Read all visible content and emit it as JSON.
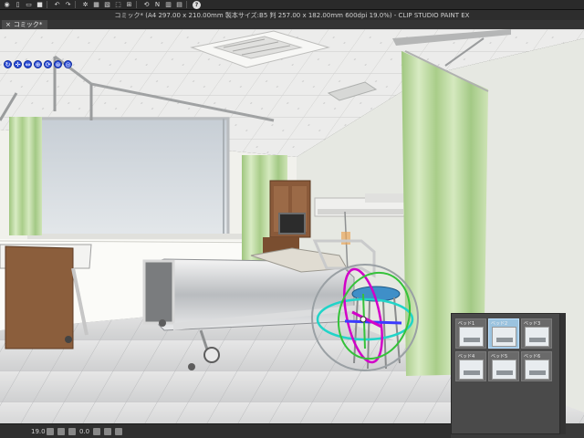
{
  "app": {
    "window_title": "コミック* (A4 297.00 x 210.00mm 製本サイズ:B5 判 257.00 x 182.00mm 600dpi 19.0%) - CLIP STUDIO PAINT EX",
    "document_tab": "コミック*"
  },
  "status": {
    "zoom": "19.0",
    "angle": "0.0"
  },
  "material_palette": {
    "items": [
      {
        "label": "ベッド1",
        "selected": false
      },
      {
        "label": "ベッド2",
        "selected": true
      },
      {
        "label": "ベッド3",
        "selected": false
      },
      {
        "label": "ベッド4",
        "selected": false
      },
      {
        "label": "ベッド5",
        "selected": false
      },
      {
        "label": "ベッド6",
        "selected": false
      }
    ]
  },
  "toolbar_3d": {
    "icons": [
      "camera-rotate-icon",
      "camera-pan-icon",
      "camera-move-icon",
      "camera-zoom-icon",
      "object-rotate-icon",
      "object-move-icon",
      "object-rotate-y-icon"
    ]
  },
  "colors": {
    "ui_dark": "#2d2d2d",
    "curtain": "#b5d39a",
    "floor": "#d9dadb",
    "gizmo_magenta": "#d200c8",
    "gizmo_cyan": "#21d4c8",
    "gizmo_green": "#35c23a",
    "gizmo_blue": "#3b3bff"
  }
}
